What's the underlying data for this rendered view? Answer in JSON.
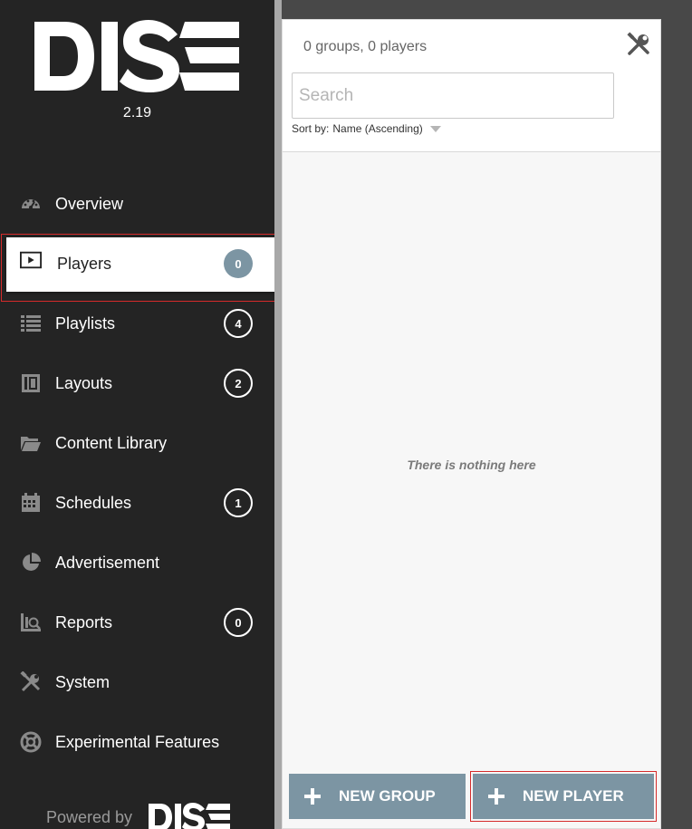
{
  "app": {
    "logo_text": "DISE",
    "version": "2.19",
    "powered_by": "Powered by"
  },
  "colors": {
    "sidebar_bg": "#242424",
    "accent": "#7c95a3",
    "highlight_border": "#d52b2b"
  },
  "sidebar": {
    "items": [
      {
        "label": "Overview",
        "icon": "dashboard-icon",
        "badge": null
      },
      {
        "label": "Players",
        "icon": "player-screen-icon",
        "badge": "0",
        "active": true
      },
      {
        "label": "Playlists",
        "icon": "playlist-icon",
        "badge": "4"
      },
      {
        "label": "Layouts",
        "icon": "layout-icon",
        "badge": "2"
      },
      {
        "label": "Content Library",
        "icon": "folder-icon",
        "badge": null
      },
      {
        "label": "Schedules",
        "icon": "calendar-icon",
        "badge": "1"
      },
      {
        "label": "Advertisement",
        "icon": "pie-chart-icon",
        "badge": null
      },
      {
        "label": "Reports",
        "icon": "report-search-icon",
        "badge": "0"
      },
      {
        "label": "System",
        "icon": "tools-icon",
        "badge": null
      },
      {
        "label": "Experimental Features",
        "icon": "lifebuoy-icon",
        "badge": null
      }
    ]
  },
  "main": {
    "summary": "0 groups, 0 players",
    "search": {
      "placeholder": "Search",
      "value": ""
    },
    "sort": {
      "label": "Sort by:",
      "value": "Name (Ascending)"
    },
    "empty_message": "There is nothing here",
    "buttons": {
      "new_group": "NEW GROUP",
      "new_player": "NEW PLAYER"
    }
  }
}
